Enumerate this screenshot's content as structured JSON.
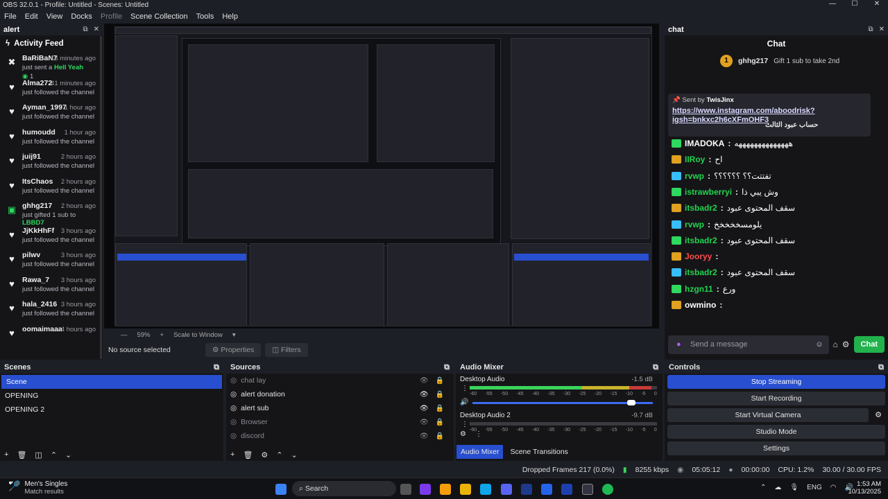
{
  "window": {
    "title": "OBS 32.0.1 - Profile: Untitled - Scenes: Untitled",
    "min": "—",
    "max": "☐",
    "close": "✕"
  },
  "menu": [
    "File",
    "Edit",
    "View",
    "Docks",
    "Profile",
    "Scene Collection",
    "Tools",
    "Help"
  ],
  "alert_dock": {
    "title": "alert",
    "feed_title": "Activity Feed",
    "items": [
      {
        "name": "BaRiBaN7",
        "time": "16 minutes ago",
        "desc": "just sent a",
        "extra": "Hell Yeah",
        "count": "1",
        "icon": "hell-yeah-icon"
      },
      {
        "name": "Alma272",
        "time": "41 minutes ago",
        "desc": "just followed the channel",
        "icon": "heart-icon"
      },
      {
        "name": "Ayman_1997",
        "time": "1 hour ago",
        "desc": "just followed the channel",
        "icon": "heart-icon"
      },
      {
        "name": "humoudd",
        "time": "1 hour ago",
        "desc": "just followed the channel",
        "icon": "heart-icon"
      },
      {
        "name": "juij91",
        "time": "2 hours ago",
        "desc": "just followed the channel",
        "icon": "heart-icon"
      },
      {
        "name": "ItsChaos",
        "time": "2 hours ago",
        "desc": "just followed the channel",
        "icon": "heart-icon"
      },
      {
        "name": "ghhg217",
        "time": "2 hours ago",
        "desc": "just gifted 1 sub to",
        "extra": "LBBD7",
        "icon": "gift-icon"
      },
      {
        "name": "JjKkHhFf",
        "time": "3 hours ago",
        "desc": "just followed the channel",
        "icon": "heart-icon"
      },
      {
        "name": "pilwv",
        "time": "3 hours ago",
        "desc": "just followed the channel",
        "icon": "heart-icon"
      },
      {
        "name": "Rawa_7",
        "time": "3 hours ago",
        "desc": "just followed the channel",
        "icon": "heart-icon"
      },
      {
        "name": "hala_2416",
        "time": "3 hours ago",
        "desc": "just followed the channel",
        "icon": "heart-icon"
      },
      {
        "name": "oomaimaaa",
        "time": "4 hours ago",
        "desc": "",
        "icon": "heart-icon"
      }
    ]
  },
  "preview": {
    "zoom": "59%",
    "scale": "Scale to Window"
  },
  "context_bar": {
    "no_source": "No source selected",
    "properties": "Properties",
    "filters": "Filters"
  },
  "chat_dock": {
    "title": "chat",
    "heading": "Chat",
    "gift_user": "ghhg217",
    "gift_coin": "1",
    "gift_text": "Gift 1 sub to take 2nd",
    "pinned_by": "Sent by",
    "pinned_user": "TwisJinx",
    "pinned_link": "https://www.instagram.com/aboodrisk?igsh=bnkxc2h6cXFmOHF3",
    "pinned_suffix": "حساب عبود الثالث",
    "messages": [
      {
        "user": "IMADOKA",
        "text": "ههههههههههههههه",
        "color": "#ffffff"
      },
      {
        "user": "IIRoy",
        "text": "اح",
        "color": "#22d34f"
      },
      {
        "user": "rvwp",
        "text": "تفتتت؟؟ ؟؟؟؟؟؟",
        "color": "#22d34f"
      },
      {
        "user": "istrawberryi",
        "text": "وش يبي ذا",
        "color": "#22d34f"
      },
      {
        "user": "itsbadr2",
        "text": "سقف المحتوى عبود",
        "color": "#22d34f"
      },
      {
        "user": "rvwp",
        "text": "يلومسخخخخخ",
        "color": "#22d34f"
      },
      {
        "user": "itsbadr2",
        "text": "سقف المحتوى عبود",
        "color": "#22d34f"
      },
      {
        "user": "Jooryy",
        "text": "",
        "color": "#ff4b4b"
      },
      {
        "user": "itsbadr2",
        "text": "سقف المحتوى عبود",
        "color": "#22d34f"
      },
      {
        "user": "hzgn11",
        "text": "ورع",
        "color": "#22d34f"
      },
      {
        "user": "owmino",
        "text": "",
        "color": "#ffffff"
      }
    ],
    "input_placeholder": "Send a message",
    "chat_button": "Chat"
  },
  "scenes": {
    "title": "Scenes",
    "items": [
      "Scene",
      "OPENING",
      "OPENING 2"
    ]
  },
  "sources": {
    "title": "Sources",
    "items": [
      "chat lay",
      "alert donation",
      "alert sub",
      "Browser",
      "discord"
    ]
  },
  "mixer": {
    "title": "Audio Mixer",
    "tracks": [
      {
        "name": "Desktop Audio",
        "db": "-1.5 dB",
        "level": 0.97,
        "volume": 0.88
      },
      {
        "name": "Desktop Audio 2",
        "db": "-9.7 dB",
        "level": 0.0,
        "volume": 0.88
      }
    ],
    "ticks": [
      "-60",
      "-55",
      "-50",
      "-45",
      "-40",
      "-35",
      "-30",
      "-25",
      "-20",
      "-15",
      "-10",
      "-5",
      "0"
    ],
    "tab_mixer": "Audio Mixer",
    "tab_transitions": "Scene Transitions"
  },
  "controls": {
    "title": "Controls",
    "buttons": [
      "Stop Streaming",
      "Start Recording",
      "Start Virtual Camera",
      "Studio Mode",
      "Settings"
    ]
  },
  "status": {
    "dropped": "Dropped Frames 217 (0.0%)",
    "kbps": "8255 kbps",
    "time_live": "05:05:12",
    "time_rec": "00:00:00",
    "cpu": "CPU: 1.2%",
    "fps": "30.00 / 30.00 FPS"
  },
  "taskbar": {
    "widget_title": "Men's Singles",
    "widget_sub": "Match results",
    "search": "Search",
    "lang": "ENG",
    "time": "1:53 AM",
    "date": "10/13/2025"
  },
  "colors": {
    "accent": "#284fd0",
    "green": "#22b24c",
    "panel": "#151518",
    "bar": "#1d1f26"
  }
}
